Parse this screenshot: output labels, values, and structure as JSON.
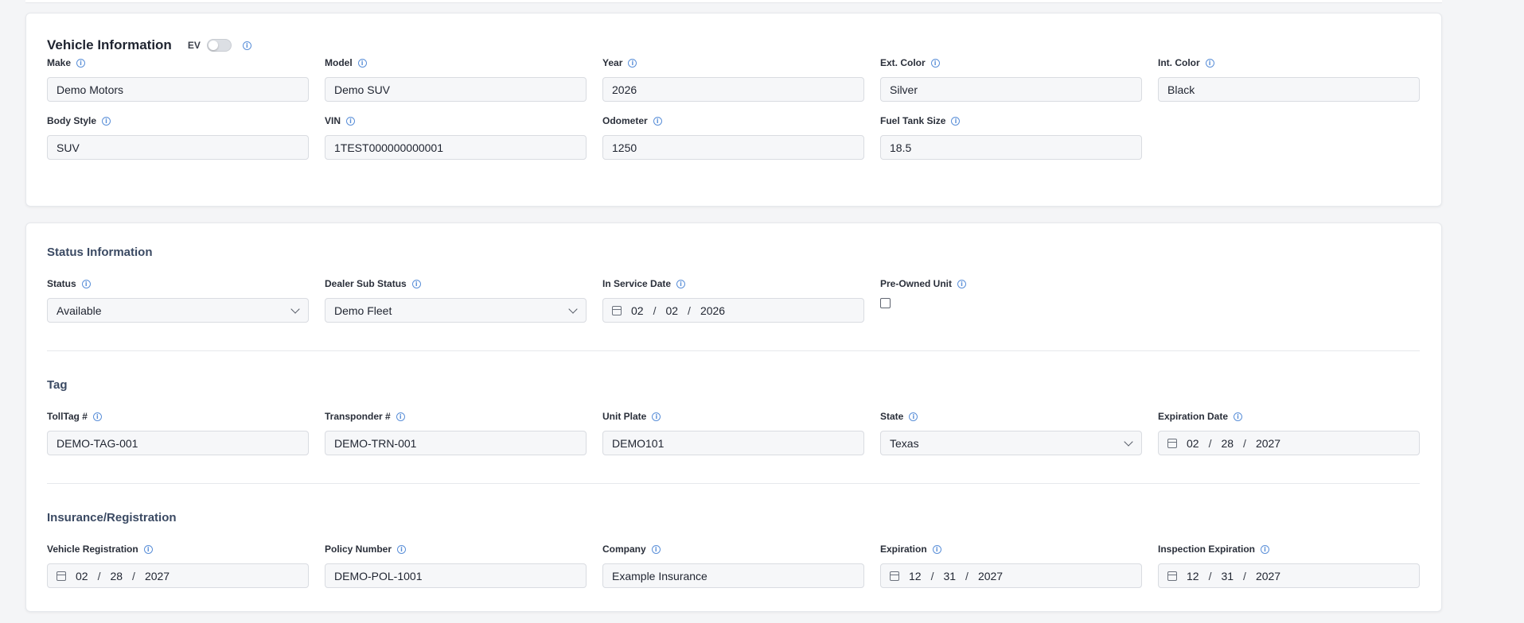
{
  "vehicle": {
    "title": "Vehicle Information",
    "ev_label": "EV",
    "ev_enabled": false,
    "fields": {
      "make": {
        "label": "Make",
        "value": "Demo Motors"
      },
      "model": {
        "label": "Model",
        "value": "Demo SUV"
      },
      "year": {
        "label": "Year",
        "value": "2026"
      },
      "ext_color": {
        "label": "Ext. Color",
        "value": "Silver"
      },
      "int_color": {
        "label": "Int. Color",
        "value": "Black"
      },
      "body_style": {
        "label": "Body Style",
        "value": "SUV"
      },
      "vin": {
        "label": "VIN",
        "value": "1TEST000000000001"
      },
      "odometer": {
        "label": "Odometer",
        "value": "1250"
      },
      "fuel_tank": {
        "label": "Fuel Tank Size",
        "value": "18.5"
      }
    }
  },
  "status_info": {
    "title": "Status Information",
    "status": {
      "label": "Status",
      "value": "Available"
    },
    "dealer_sub_status": {
      "label": "Dealer Sub Status",
      "value": "Demo Fleet"
    },
    "in_service_date": {
      "label": "In Service Date",
      "month": "02",
      "day": "02",
      "year": "2026"
    },
    "pre_owned": {
      "label": "Pre-Owned Unit",
      "checked": false
    }
  },
  "tag": {
    "title": "Tag",
    "toll_tag": {
      "label": "TollTag #",
      "value": "DEMO-TAG-001"
    },
    "transponder": {
      "label": "Transponder #",
      "value": "DEMO-TRN-001"
    },
    "unit_plate": {
      "label": "Unit Plate",
      "value": "DEMO101"
    },
    "state": {
      "label": "State",
      "value": "Texas"
    },
    "expiration_date": {
      "label": "Expiration Date",
      "month": "02",
      "day": "28",
      "year": "2027"
    }
  },
  "insurance": {
    "title": "Insurance/Registration",
    "vehicle_registration": {
      "label": "Vehicle Registration",
      "month": "02",
      "day": "28",
      "year": "2027"
    },
    "policy_number": {
      "label": "Policy Number",
      "value": "DEMO-POL-1001"
    },
    "company": {
      "label": "Company",
      "value": "Example Insurance"
    },
    "expiration": {
      "label": "Expiration",
      "month": "12",
      "day": "31",
      "year": "2027"
    },
    "inspection_expiration": {
      "label": "Inspection Expiration",
      "month": "12",
      "day": "31",
      "year": "2027"
    }
  },
  "colors": {
    "accent": "#5a8fd8",
    "section_title": "#3b4a63",
    "input_bg": "#f6f7f9"
  },
  "icons": {
    "info": "info-circle-icon",
    "calendar": "calendar-icon",
    "chevron": "chevron-down-icon"
  }
}
